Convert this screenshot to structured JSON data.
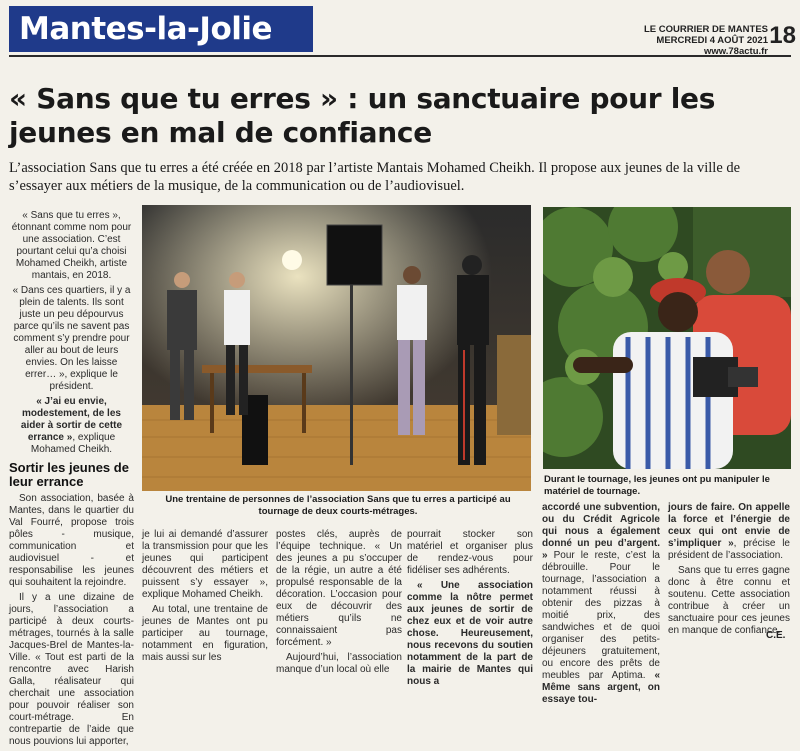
{
  "header": {
    "section": "Mantes-la-Jolie",
    "publication": "LE COURRIER DE MANTES",
    "date": "MERCREDI 4 AOÛT 2021",
    "website": "www.78actu.fr",
    "page_number": "18"
  },
  "headline": "« Sans que tu erres » : un sanctuaire pour les jeunes en mal de confiance",
  "intro": "L’association Sans que tu erres a été créée en 2018 par l’artiste Mantais Mohamed Cheikh. Il propose aux jeunes de la ville de s’essayer aux métiers de la musique, de la communication ou de l’audiovisuel.",
  "left_column": {
    "p1": "« Sans que tu erres », étonnant comme nom pour une association. C’est pourtant celui qu’a choisi Mohamed Cheikh, artiste mantais, en 2018.",
    "p2": "« Dans ces quartiers, il y a plein de talents. Ils sont juste un peu dépourvus parce qu’ils ne savent pas comment s’y prendre pour aller au bout de leurs envies. On les laisse errer… », explique le président.",
    "p3_bold": "« J’ai eu envie, modestement, de les aider à sortir de cette errance »",
    "p3_rest": ", explique Mohamed Cheikh.",
    "subhead": "Sortir les jeunes de leur errance",
    "p4": "Son association, basée à Mantes, dans le quartier du Val Fourré, propose trois pôles - musique, communication et audiovisuel - et responsabilise les jeunes qui souhaitent la rejoindre.",
    "p5": "Il y a une dizaine de jours, l’association a participé à deux courts-métrages, tournés à la salle Jacques-Brel de Mantes-la-Ville. « Tout est parti de la rencontre avec Harish Galla, réalisateur qui cherchait une association pour pouvoir réaliser son court-métrage. En contrepartie de l’aide que nous pouvions lui apporter,"
  },
  "captions": {
    "studio": "Une trentaine de personnes de l’association Sans que tu erres a participé au tournage de deux courts-métrages.",
    "outdoor": "Durant le tournage, les jeunes ont pu manipuler le matériel de tournage."
  },
  "bottom_columns": {
    "col1": {
      "p1": "je lui ai demandé d’assurer la transmission pour que les jeunes qui participent découvrent des métiers et puissent s’y essayer », explique Mohamed Cheikh.",
      "p2": "Au total, une trentaine de jeunes de Mantes ont pu participer au tournage, notamment en figuration, mais aussi sur les"
    },
    "col2": {
      "p1": "postes clés, auprès de l’équipe technique. « Un des jeunes a pu s’occuper de la régie, un autre a été propulsé responsable de la décoration. L’occasion pour eux de découvrir des métiers qu’ils ne connaissaient pas forcément. »",
      "p2": "Aujourd’hui, l’association manque d’un local où elle"
    },
    "col3": {
      "p1": "pourrait stocker son matériel et organiser plus de rendez-vous pour fidéliser ses adhérents.",
      "p2_bold": "« Une association comme la nôtre permet aux jeunes de sortir de chez eux et de voir autre chose. Heureusement, nous recevons du soutien notamment de la part de la mairie de Mantes qui nous a"
    },
    "col4": {
      "p1_start": "accordé une subvention, ou du Crédit Agricole qui nous a également donné un peu d’argent. »",
      "p1_rest": " Pour le reste, c’est la débrouille. Pour le tournage, l’association a notamment réussi à obtenir des pizzas à moitié prix, des sandwiches et de quoi organiser des petits-déjeuners gratuitement, ou encore des prêts de meubles par Aptima. ",
      "p1_end_bold": "« Même sans argent, on essaye tou-"
    },
    "col5": {
      "p1_bold": "jours de faire. On appelle la force et l’énergie de ceux qui ont envie de s’impliquer »",
      "p1_rest": ", précise le président de l’association.",
      "p2": "Sans que tu erres gagne donc à être connu et soutenu. Cette association contribue à créer un sanctuaire pour ces jeunes en manque de confiance."
    }
  },
  "signature": "C.E.",
  "colors": {
    "banner": "#1f3a8a",
    "paper": "#f3f1ea"
  }
}
